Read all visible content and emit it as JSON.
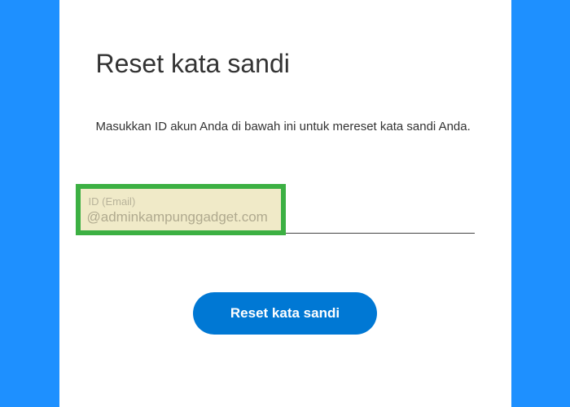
{
  "header": {
    "title": "Reset kata sandi"
  },
  "instruction": "Masukkan ID akun Anda di bawah ini untuk mereset kata sandi Anda.",
  "form": {
    "id_label": "ID (Email)",
    "email_value": "@adminkampunggadget.com"
  },
  "actions": {
    "reset_label": "Reset kata sandi"
  }
}
